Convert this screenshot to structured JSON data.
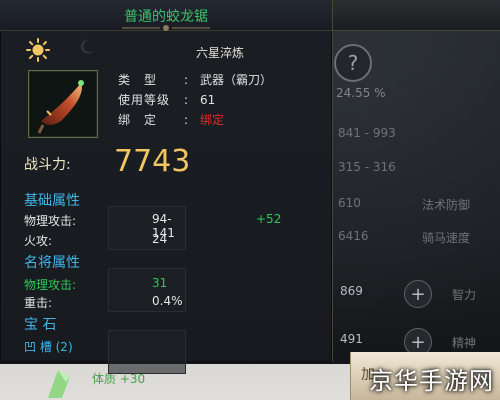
{
  "tooltip": {
    "title": "普通的蛟龙锯",
    "refine_text": "六星淬炼",
    "attributes": [
      {
        "key": "类　型",
        "value": "武器（霸刀）",
        "color": "#dfe1e3"
      },
      {
        "key": "使用等级",
        "value": "61",
        "color": "#dfe1e3"
      },
      {
        "key": "绑　定",
        "value": "绑定",
        "color": "#e12b2b"
      }
    ],
    "combat_power_label": "战斗力:",
    "combat_power_value": "7743",
    "basic_section_title": "基础属性",
    "basic_stats": [
      {
        "label": "物理攻击:",
        "value": "94-141",
        "bonus": "+52"
      },
      {
        "label": "火攻:",
        "value": "24",
        "bonus": ""
      }
    ],
    "general_section_title": "名将属性",
    "general_stats": [
      {
        "label": "物理攻击:",
        "value": "31"
      },
      {
        "label": "重击:",
        "value": "0.4%"
      }
    ],
    "gem_section_title": "宝 石",
    "slot_label": "凹 槽 (2)"
  },
  "background": {
    "stat_lines": [
      "24.55 %",
      "841 - 993",
      "315 - 316",
      "610",
      "6416",
      "869",
      "491"
    ],
    "labels": [
      "法术防御",
      "骑马速度",
      "智力",
      "精神"
    ],
    "bottom_text": "体质 +30",
    "button_text": "加"
  },
  "watermark": "京华手游网",
  "icons": {
    "sun": "sun-icon",
    "moon": "moon-icon",
    "help": "question-icon",
    "plus": "plus-icon",
    "weapon": "weapon-icon"
  },
  "colors": {
    "title_green": "#3dbf6b",
    "section_blue": "#3fb5e8",
    "bonus_green": "#2ec95c",
    "bound_red": "#e12b2b",
    "power_gold": "#f0c663"
  }
}
